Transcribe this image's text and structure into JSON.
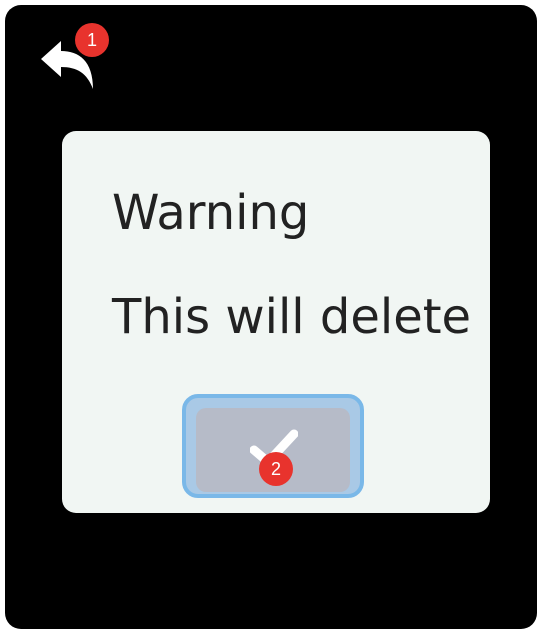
{
  "annotations": {
    "marker_1": "1",
    "marker_2": "2"
  },
  "dialog": {
    "title": "Warning",
    "message": "This will delete",
    "confirm_icon": "checkmark-icon"
  },
  "toolbar": {
    "back_icon": "back-arrow-icon"
  },
  "colors": {
    "screen_bg": "#000000",
    "dialog_bg": "#f1f6f3",
    "button_bg": "#b6bbc8",
    "focus_ring": "#7ab8e8",
    "marker": "#e8332d"
  }
}
